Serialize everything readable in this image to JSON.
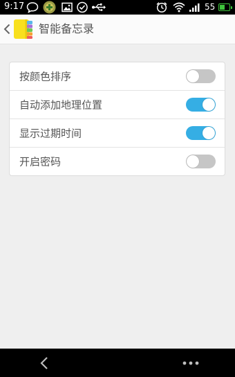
{
  "status_bar": {
    "time": "9:17",
    "battery_percent": "55",
    "battery_level": 0.55,
    "icons": [
      "chat-bubble-icon",
      "game-app-icon",
      "image-icon",
      "check-circle-icon",
      "usb-icon",
      "alarm-icon",
      "wifi-icon",
      "signal-icon",
      "battery-icon"
    ],
    "battery_color": "#3fc53c"
  },
  "title_bar": {
    "title": "智能备忘录",
    "back_icon": "chevron-left-icon",
    "logo_icon": "notebook-logo-icon"
  },
  "settings": [
    {
      "label": "按颜色排序",
      "on": false
    },
    {
      "label": "自动添加地理位置",
      "on": true
    },
    {
      "label": "显示过期时间",
      "on": true
    },
    {
      "label": "开启密码",
      "on": false
    }
  ],
  "colors": {
    "toggle_on": "#35aee4",
    "toggle_off": "#c6c6c6"
  },
  "nav_bar": {
    "icons": [
      "back-arrow-icon",
      "more-dots-icon"
    ]
  }
}
